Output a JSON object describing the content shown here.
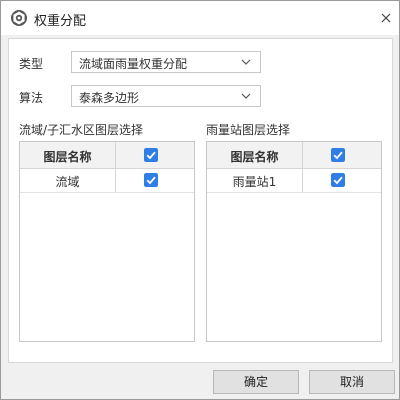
{
  "window": {
    "title": "权重分配",
    "app_icon": "gear-app-icon",
    "close_icon": "close-icon"
  },
  "form": {
    "type_label": "类型",
    "type_value": "流域面雨量权重分配",
    "algorithm_label": "算法",
    "algorithm_value": "泰森多边形"
  },
  "basin_layers": {
    "section_label": "流域/子汇水区图层选择",
    "header_name": "图层名称",
    "header_checked": true,
    "rows": [
      {
        "name": "流域",
        "checked": true
      }
    ]
  },
  "station_layers": {
    "section_label": "雨量站图层选择",
    "header_name": "图层名称",
    "header_checked": true,
    "rows": [
      {
        "name": "雨量站1",
        "checked": true
      }
    ]
  },
  "buttons": {
    "ok_label": "确定",
    "cancel_label": "取消"
  },
  "colors": {
    "checkbox": "#2f7ee6",
    "panel_bg": "#ffffff",
    "window_bg": "#f0f0f0"
  }
}
